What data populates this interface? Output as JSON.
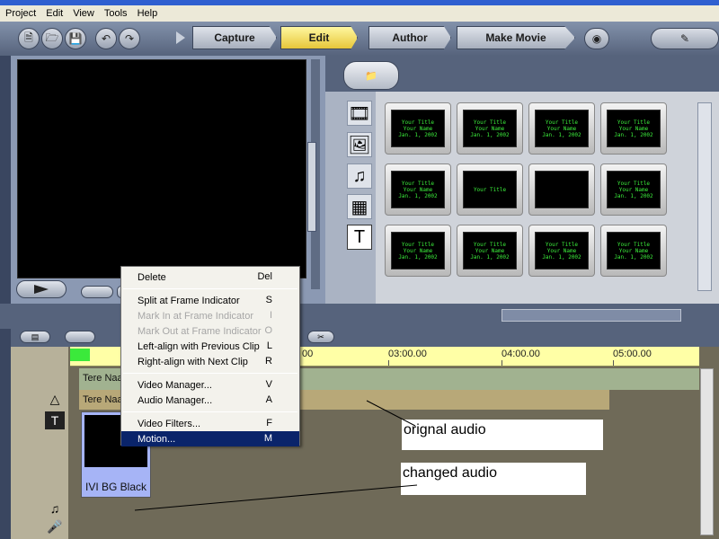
{
  "menubar": [
    "Project",
    "Edit",
    "View",
    "Tools",
    "Help"
  ],
  "steps": {
    "capture": "Capture",
    "edit": "Edit",
    "author": "Author",
    "make_movie": "Make Movie"
  },
  "timeline": {
    "ruler": [
      "00",
      "03:00.00",
      "04:00.00",
      "05:00.00"
    ],
    "video_track_label": "Tere Naa",
    "audio_track_label": "Tere Naa",
    "clip_label": "IVI BG Black"
  },
  "annotations": {
    "original": "orignal audio",
    "changed": "changed audio"
  },
  "thumbnails": [
    "Your Title\nYour Name\nJan. 1, 2002",
    "Your Title\nYour Name\nJan. 1, 2002",
    "Your Title\nYour Name\nJan. 1, 2002",
    "Your Title\nYour Name\nJan. 1, 2002",
    "Your Title\nYour Name\nJan. 1, 2002",
    "Your Title",
    "",
    "Your Title\nYour Name\nJan. 1, 2002",
    "Your Title\nYour Name\nJan. 1, 2002",
    "Your Title\nYour Name\nJan. 1, 2002",
    "Your Title\nYour Name\nJan. 1, 2002",
    "Your Title\nYour Name\nJan. 1, 2002"
  ],
  "context_menu": [
    {
      "label": "Delete",
      "key": "Del",
      "state": "normal"
    },
    {
      "sep": true
    },
    {
      "label": "Split at Frame Indicator",
      "key": "S",
      "state": "normal"
    },
    {
      "label": "Mark In at Frame Indicator",
      "key": "I",
      "state": "disabled"
    },
    {
      "label": "Mark Out at Frame Indicator",
      "key": "O",
      "state": "disabled"
    },
    {
      "label": "Left-align with Previous Clip",
      "key": "L",
      "state": "normal"
    },
    {
      "label": "Right-align with Next Clip",
      "key": "R",
      "state": "normal"
    },
    {
      "sep": true
    },
    {
      "label": "Video Manager...",
      "key": "V",
      "state": "normal"
    },
    {
      "label": "Audio Manager...",
      "key": "A",
      "state": "normal"
    },
    {
      "sep": true
    },
    {
      "label": "Video Filters...",
      "key": "F",
      "state": "normal"
    },
    {
      "label": "Motion...",
      "key": "M",
      "state": "highlighted"
    }
  ]
}
